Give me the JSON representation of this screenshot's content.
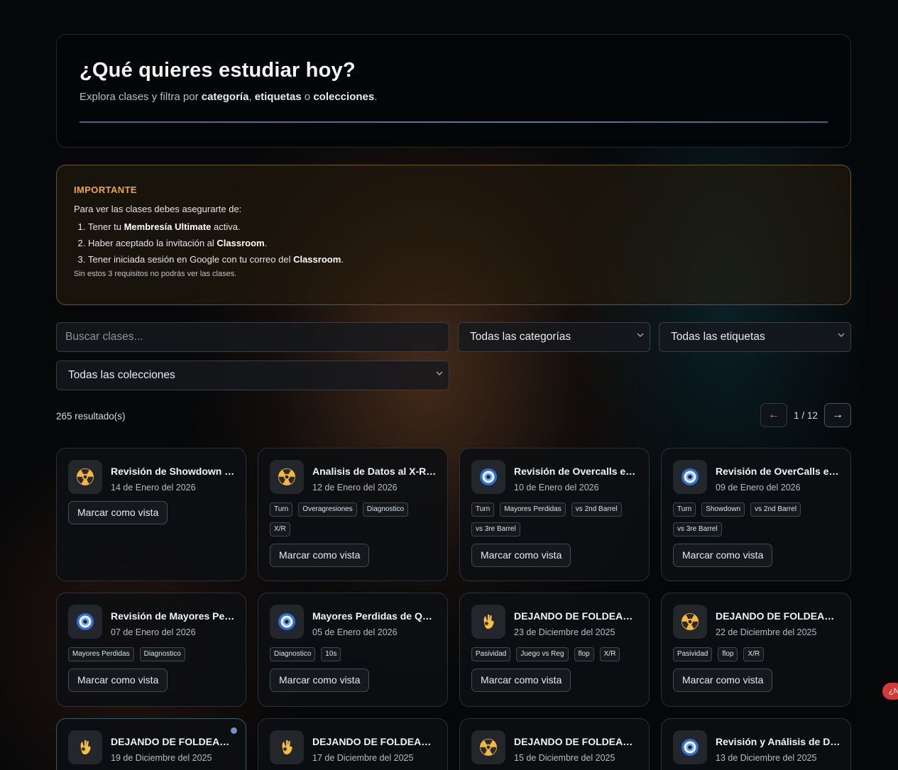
{
  "hero": {
    "title": "¿Qué quieres estudiar hoy?",
    "subtitle_lead": "Explora clases y filtra por ",
    "subtitle_cat": "categoría",
    "subtitle_sep": ", ",
    "subtitle_tags": "etiquetas",
    "subtitle_or": " o ",
    "subtitle_cols": "colecciones",
    "subtitle_end": "."
  },
  "notice": {
    "heading": "IMPORTANTE",
    "intro": "Para ver las clases debes asegurarte de:",
    "req1_a": "Tener tu ",
    "req1_b": "Membresía Ultimate",
    "req1_c": " activa.",
    "req2_a": "Haber aceptado la invitación al ",
    "req2_b": "Classroom",
    "req2_c": ".",
    "req3_a": "Tener iniciada sesión en Google con tu correo del ",
    "req3_b": "Classroom",
    "req3_c": ".",
    "footnote": "Sin estos 3 requisitos no podrás ver las clases."
  },
  "filters": {
    "search_placeholder": "Buscar clases...",
    "category": "Todas las categorías",
    "tags": "Todas las etiquetas",
    "collections": "Todas las colecciones"
  },
  "results": {
    "count": "265 resultado(s)",
    "prev": "←",
    "page": "1 / 12",
    "next": "→"
  },
  "mark_label": "Marcar como vista",
  "edge_badge": "¿N",
  "cards": [
    {
      "title": "Revisión de Showdown e...",
      "date": "14 de Enero del 2026",
      "icon": "radioactive-icon",
      "tags": []
    },
    {
      "title": "Analisis de Datos al X-R e...",
      "date": "12 de Enero del 2026",
      "icon": "radioactive-icon",
      "tags": [
        "Turn",
        "Overagresiones",
        "Diagnostico",
        "X/R"
      ]
    },
    {
      "title": "Revisión de Overcalls en ...",
      "date": "10 de Enero del 2026",
      "icon": "eye-icon",
      "tags": [
        "Turn",
        "Mayores Perdidas",
        "vs 2nd Barrel",
        "vs 3re Barrel"
      ]
    },
    {
      "title": "Revisión de OverCalls en ...",
      "date": "09 de Enero del 2026",
      "icon": "eye-icon",
      "tags": [
        "Turn",
        "Showdown",
        "vs 2nd Barrel",
        "vs 3re Barrel"
      ]
    },
    {
      "title": "Revisión de Mayores Per...",
      "date": "07 de Enero del 2026",
      "icon": "eye-icon",
      "tags": [
        "Mayores Perdidas",
        "Diagnostico"
      ]
    },
    {
      "title": "Mayores Perdidas de Qui...",
      "date": "05 de Enero del 2026",
      "icon": "eye-icon",
      "tags": [
        "Diagnostico",
        "10s"
      ]
    },
    {
      "title": "DEJANDO DE FOLDEAR E...",
      "date": "23 de Diciembre del 2025",
      "icon": "ok-hand-icon",
      "tags": [
        "Pasividad",
        "Juego vs Reg",
        "flop",
        "X/R"
      ]
    },
    {
      "title": "DEJANDO DE FOLDEAR E...",
      "date": "22 de Diciembre del 2025",
      "icon": "radioactive-icon",
      "tags": [
        "Pasividad",
        "flop",
        "X/R"
      ]
    },
    {
      "title": "DEJANDO DE FOLDEAR E...",
      "date": "19 de Diciembre del 2025",
      "icon": "ok-hand-icon",
      "tags": [],
      "highlight": true
    },
    {
      "title": "DEJANDO DE FOLDEAR E...",
      "date": "17 de Diciembre del 2025",
      "icon": "ok-hand-icon",
      "tags": []
    },
    {
      "title": "DEJANDO DE FOLDEAR E...",
      "date": "15 de Diciembre del 2025",
      "icon": "radioactive-icon",
      "tags": []
    },
    {
      "title": "Revisión y Análisis de Dat...",
      "date": "13 de Diciembre del 2025",
      "icon": "eye-icon",
      "tags": []
    }
  ]
}
